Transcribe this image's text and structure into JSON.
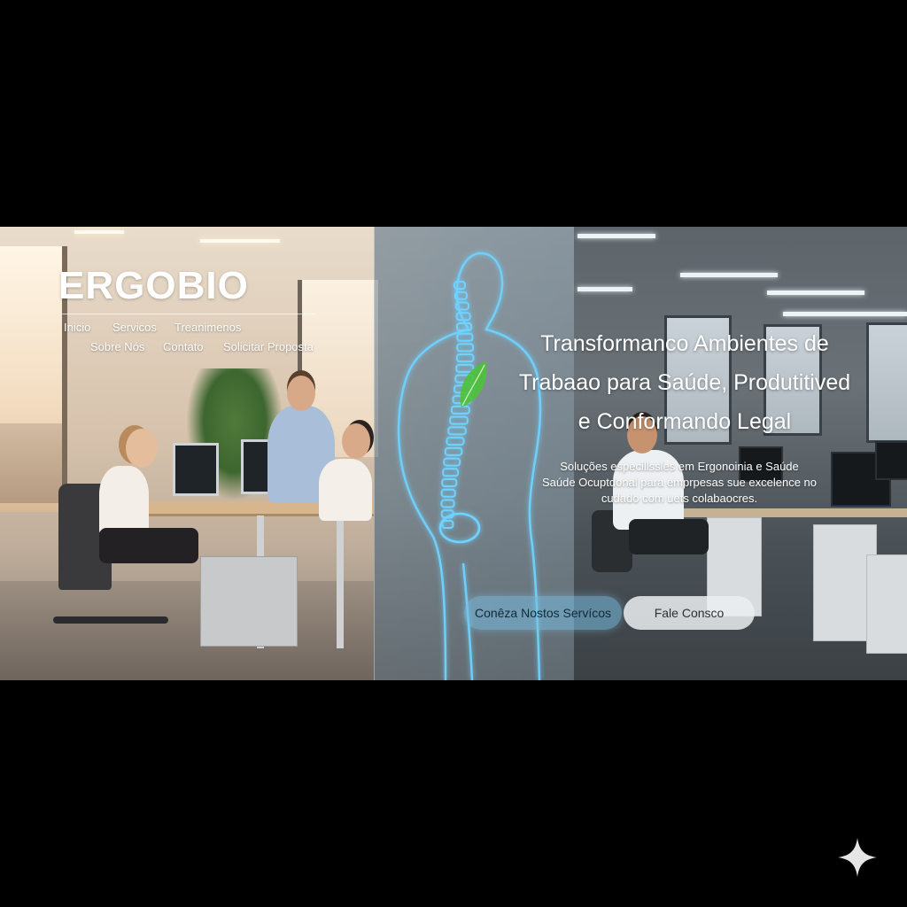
{
  "brand": {
    "logo_text": "ERGOBIO"
  },
  "nav": {
    "items": [
      "Inicio",
      "Servicos",
      "Treanimenos",
      "Sobre Nós",
      "Contato",
      "Solicitar Proposta"
    ]
  },
  "hero": {
    "headline_lines": [
      "Transformanco Ambientes de",
      "Trabaao para Saúde, Produtitived",
      "e Conformando Legal"
    ],
    "subtitle_lines": [
      "Soluções especillssles em Ergonoinia e Saúde",
      "Saúde Ocuptdonal para emprpesas sue excelence no",
      "cudado com uets colabaocres."
    ],
    "primary_button": "Conêza Nostos Servícos",
    "secondary_button": "Fale Consco"
  },
  "colors": {
    "page_background": "#000000",
    "spine_glow": "#6fd3ff",
    "leaf_green": "#4cc23a",
    "primary_button": "#78bee1",
    "secondary_button": "#ebeef1"
  },
  "icons": {
    "corner_mark": "sparkle-icon",
    "leaf": "leaf-icon"
  }
}
